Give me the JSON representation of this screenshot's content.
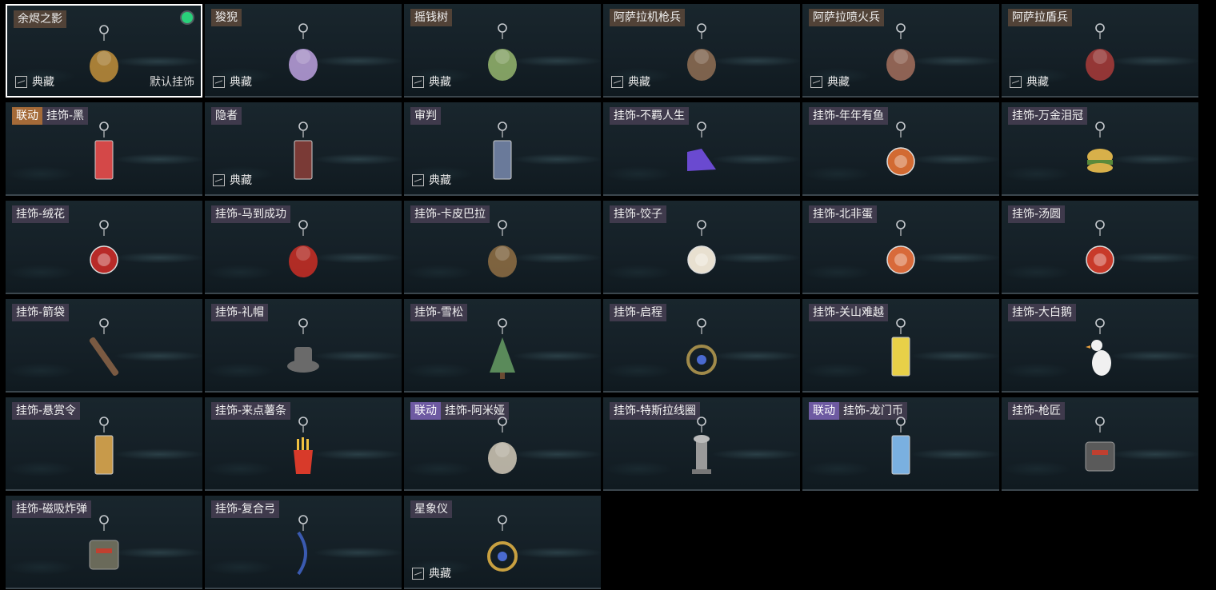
{
  "items": [
    {
      "name": "余烬之影",
      "collab": "",
      "collection": "典藏",
      "default": "默认挂饰",
      "equipped": true,
      "icon": "ember-shadow-icon",
      "color": "#b88a3a"
    },
    {
      "name": "狻猊",
      "collab": "",
      "collection": "典藏",
      "default": "",
      "equipped": false,
      "icon": "lion-charm-icon",
      "color": "#b49ad6"
    },
    {
      "name": "摇钱树",
      "collab": "",
      "collection": "典藏",
      "default": "",
      "equipped": false,
      "icon": "money-tree-icon",
      "color": "#8fae6a"
    },
    {
      "name": "阿萨拉机枪兵",
      "collab": "",
      "collection": "典藏",
      "default": "",
      "equipped": false,
      "icon": "gunner-figure-icon",
      "color": "#8a6a52"
    },
    {
      "name": "阿萨拉喷火兵",
      "collab": "",
      "collection": "典藏",
      "default": "",
      "equipped": false,
      "icon": "flamethrower-figure-icon",
      "color": "#9c6a5a"
    },
    {
      "name": "阿萨拉盾兵",
      "collab": "",
      "collection": "典藏",
      "default": "",
      "equipped": false,
      "icon": "shield-figure-icon",
      "color": "#a23a38"
    },
    {
      "name": "挂饰-黑",
      "collab": "联动",
      "collection": "",
      "default": "",
      "equipped": false,
      "icon": "card-charm-icon",
      "color": "#d44848"
    },
    {
      "name": "隐者",
      "collab": "",
      "collection": "典藏",
      "default": "",
      "equipped": false,
      "icon": "tarot-card-icon",
      "color": "#7a3a36"
    },
    {
      "name": "审判",
      "collab": "",
      "collection": "典藏",
      "default": "",
      "equipped": false,
      "icon": "judgment-card-icon",
      "color": "#6a7a9a"
    },
    {
      "name": "挂饰-不羁人生",
      "collab": "",
      "collection": "",
      "default": "",
      "equipped": false,
      "icon": "sneaker-icon",
      "color": "#6a4ad0"
    },
    {
      "name": "挂饰-年年有鱼",
      "collab": "",
      "collection": "",
      "default": "",
      "equipped": false,
      "icon": "fish-plate-icon",
      "color": "#d26a32"
    },
    {
      "name": "挂饰-万金泪冠",
      "collab": "",
      "collection": "",
      "default": "",
      "equipped": false,
      "icon": "burger-icon",
      "color": "#d8b04a"
    },
    {
      "name": "挂饰-绒花",
      "collab": "",
      "collection": "",
      "default": "",
      "equipped": false,
      "icon": "rose-icon",
      "color": "#b82a28"
    },
    {
      "name": "挂饰-马到成功",
      "collab": "",
      "collection": "",
      "default": "",
      "equipped": false,
      "icon": "horse-icon",
      "color": "#c22e26"
    },
    {
      "name": "挂饰-卡皮巴拉",
      "collab": "",
      "collection": "",
      "default": "",
      "equipped": false,
      "icon": "capybara-icon",
      "color": "#8a6a42"
    },
    {
      "name": "挂饰-饺子",
      "collab": "",
      "collection": "",
      "default": "",
      "equipped": false,
      "icon": "dumpling-plate-icon",
      "color": "#e8e0d0"
    },
    {
      "name": "挂饰-北非蛋",
      "collab": "",
      "collection": "",
      "default": "",
      "equipped": false,
      "icon": "pan-egg-icon",
      "color": "#d86a3a"
    },
    {
      "name": "挂饰-汤圆",
      "collab": "",
      "collection": "",
      "default": "",
      "equipped": false,
      "icon": "bowl-icon",
      "color": "#c83a2a"
    },
    {
      "name": "挂饰-箭袋",
      "collab": "",
      "collection": "",
      "default": "",
      "equipped": false,
      "icon": "quiver-icon",
      "color": "#7a5a42"
    },
    {
      "name": "挂饰-礼帽",
      "collab": "",
      "collection": "",
      "default": "",
      "equipped": false,
      "icon": "top-hat-icon",
      "color": "#6a6a6a"
    },
    {
      "name": "挂饰-雪松",
      "collab": "",
      "collection": "",
      "default": "",
      "equipped": false,
      "icon": "pine-tree-icon",
      "color": "#5a8a5a"
    },
    {
      "name": "挂饰-启程",
      "collab": "",
      "collection": "",
      "default": "",
      "equipped": false,
      "icon": "medal-icon",
      "color": "#a08a4a"
    },
    {
      "name": "挂饰-关山难越",
      "collab": "",
      "collection": "",
      "default": "",
      "equipped": false,
      "icon": "yellow-bar-icon",
      "color": "#e8d048"
    },
    {
      "name": "挂饰-大白鹅",
      "collab": "",
      "collection": "",
      "default": "",
      "equipped": false,
      "icon": "goose-icon",
      "color": "#f0f0f0"
    },
    {
      "name": "挂饰-悬赏令",
      "collab": "",
      "collection": "",
      "default": "",
      "equipped": false,
      "icon": "scroll-icon",
      "color": "#c89a4a"
    },
    {
      "name": "挂饰-来点薯条",
      "collab": "",
      "collection": "",
      "default": "",
      "equipped": false,
      "icon": "fries-icon",
      "color": "#d83a2a"
    },
    {
      "name": "挂饰-阿米娅",
      "collab": "联动",
      "collection": "",
      "default": "",
      "equipped": false,
      "icon": "bunny-figure-icon",
      "color": "#c8c0b0"
    },
    {
      "name": "挂饰-特斯拉线圈",
      "collab": "",
      "collection": "",
      "default": "",
      "equipped": false,
      "icon": "tesla-coil-icon",
      "color": "#9a9a9a"
    },
    {
      "name": "挂饰-龙门币",
      "collab": "联动",
      "collection": "",
      "default": "",
      "equipped": false,
      "icon": "coin-card-icon",
      "color": "#7ab0e0"
    },
    {
      "name": "挂饰-枪匠",
      "collab": "",
      "collection": "",
      "default": "",
      "equipped": false,
      "icon": "toolbox-icon",
      "color": "#5a5a5a"
    },
    {
      "name": "挂饰-磁吸炸弹",
      "collab": "",
      "collection": "",
      "default": "",
      "equipped": false,
      "icon": "bomb-icon",
      "color": "#6a6a5a"
    },
    {
      "name": "挂饰-复合弓",
      "collab": "",
      "collection": "",
      "default": "",
      "equipped": false,
      "icon": "bow-icon",
      "color": "#3a5ab0"
    },
    {
      "name": "星象仪",
      "collab": "",
      "collection": "典藏",
      "default": "",
      "equipped": false,
      "icon": "astrolabe-icon",
      "color": "#c8a040"
    }
  ]
}
